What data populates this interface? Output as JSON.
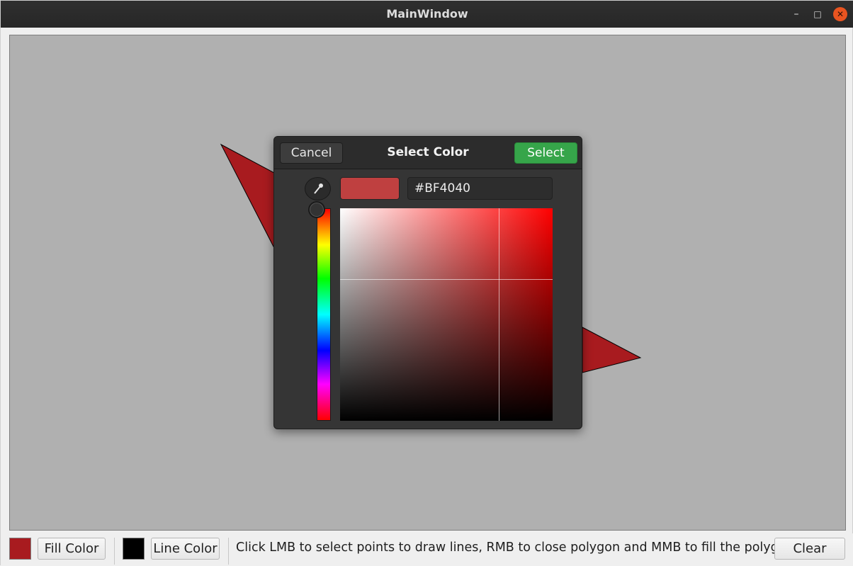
{
  "window": {
    "title": "MainWindow"
  },
  "toolbar": {
    "fill_color": "#a81b1f",
    "fill_label": "Fill Color",
    "line_color": "#000000",
    "line_label": "Line Color",
    "status": "Click LMB to select points to draw lines, RMB to close polygon and MMB to fill the polygon.",
    "clear_label": "Clear"
  },
  "dialog": {
    "cancel_label": "Cancel",
    "title": "Select Color",
    "select_label": "Select",
    "hex_value": "#BF4040"
  }
}
